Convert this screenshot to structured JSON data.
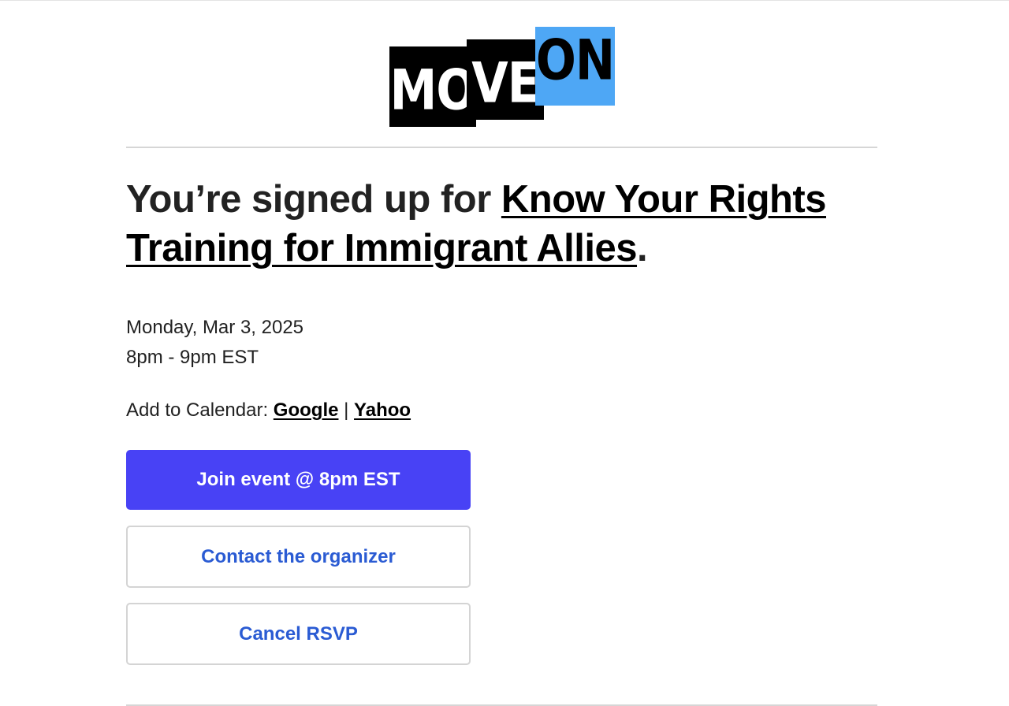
{
  "logo": {
    "part_move": "MO",
    "part_ve": "VE",
    "part_on": "ON",
    "colors": {
      "black": "#000000",
      "blue": "#4ea7f5"
    }
  },
  "heading": {
    "prefix": "You’re signed up for ",
    "event_title": "Know Your Rights Training for Immigrant Allies",
    "suffix": "."
  },
  "event": {
    "date": "Monday, Mar 3, 2025",
    "time": "8pm - 9pm EST"
  },
  "calendar": {
    "label": "Add to Calendar: ",
    "google": "Google",
    "separator": " | ",
    "yahoo": "Yahoo"
  },
  "buttons": {
    "join": "Join event @ 8pm EST",
    "contact": "Contact the organizer",
    "cancel": "Cancel RSVP"
  },
  "colors": {
    "primary_button": "#4842f5",
    "link_blue": "#2a5bd3"
  }
}
